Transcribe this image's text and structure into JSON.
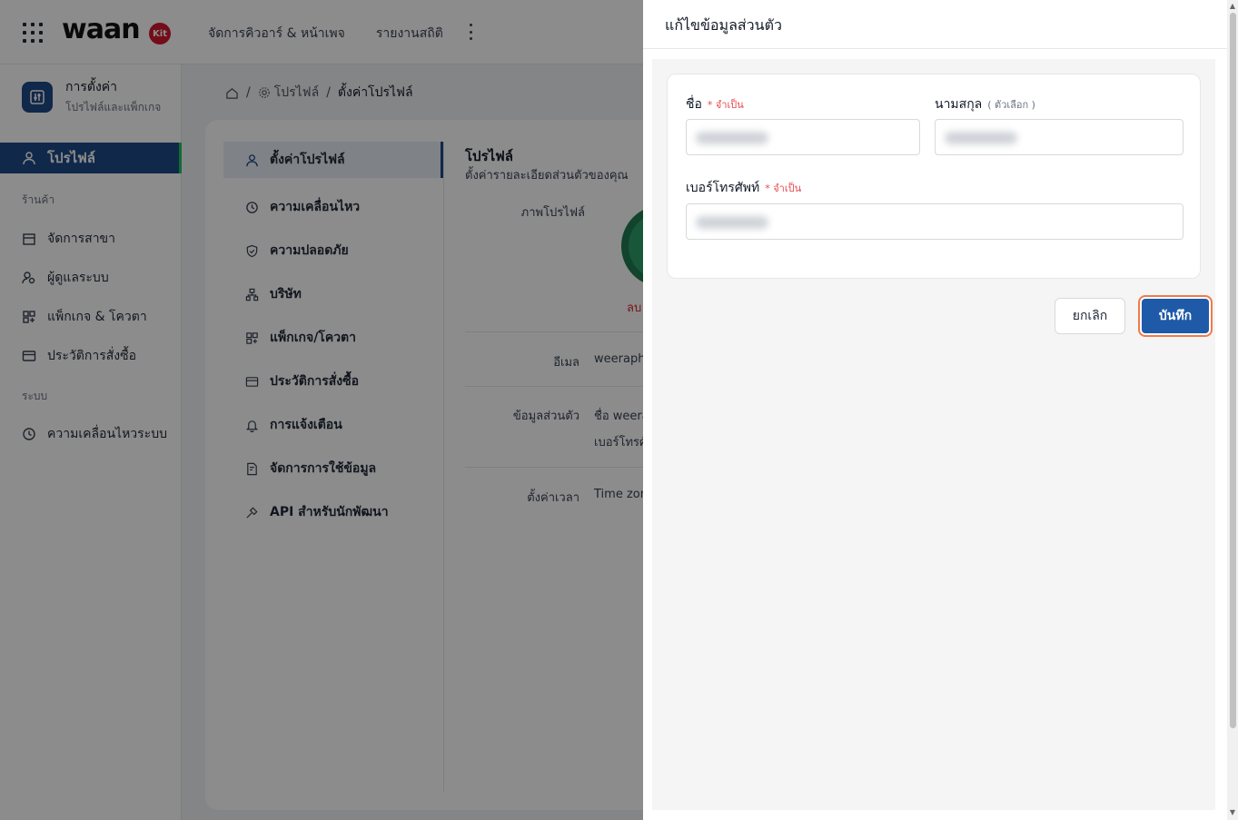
{
  "topbar": {
    "logo": "waan",
    "logo_badge": "Kit",
    "nav": [
      "จัดการคิวอาร์ & หน้าเพจ",
      "รายงานสถิติ"
    ]
  },
  "sidebar": {
    "header_title": "การตั้งค่า",
    "header_subtitle": "โปรไฟล์และแพ็กเกจ",
    "active_item": "โปรไฟล์",
    "section_store": "ร้านค้า",
    "store_items": [
      "จัดการสาขา",
      "ผู้ดูแลระบบ",
      "แพ็กเกจ & โควตา",
      "ประวัติการสั่งซื้อ"
    ],
    "section_system": "ระบบ",
    "system_items": [
      "ความเคลื่อนไหวระบบ"
    ]
  },
  "breadcrumb": {
    "item1": "โปรไฟล์",
    "item2": "ตั้งค่าโปรไฟล์"
  },
  "settings_menu": [
    "ตั้งค่าโปรไฟล์",
    "ความเคลื่อนไหว",
    "ความปลอดภัย",
    "บริษัท",
    "แพ็กเกจ/โควตา",
    "ประวัติการสั่งซื้อ",
    "การแจ้งเตือน",
    "จัดการการใช้ข้อมูล",
    "API สำหรับนักพัฒนา"
  ],
  "profile_pane": {
    "title": "โปรไฟล์",
    "subtitle": "ตั้งค่ารายละเอียดส่วนตัวของคุณ",
    "photo_label": "ภาพโปรไฟล์",
    "delete_link": "ลบ",
    "email_label": "อีเมล",
    "email_value": "weerapha",
    "personal_label": "ข้อมูลส่วนตัว",
    "personal_value1": "ชื่อ weera",
    "personal_value2": "เบอร์โทรศั",
    "time_label": "ตั้งค่าเวลา",
    "time_value": "Time zon"
  },
  "drawer": {
    "title": "แก้ไขข้อมูลส่วนตัว",
    "first_name_label": "ชื่อ",
    "first_name_required": "* จำเป็น",
    "last_name_label": "นามสกุล",
    "last_name_optional": "( ตัวเลือก )",
    "phone_label": "เบอร์โทรศัพท์",
    "phone_required": "* จำเป็น",
    "cancel_label": "ยกเลิก",
    "save_label": "บันทึก"
  },
  "colors": {
    "primary": "#1e4a87",
    "save_button": "#1e5aa8",
    "focus_ring": "#f07b4a",
    "required": "#e5484d"
  }
}
